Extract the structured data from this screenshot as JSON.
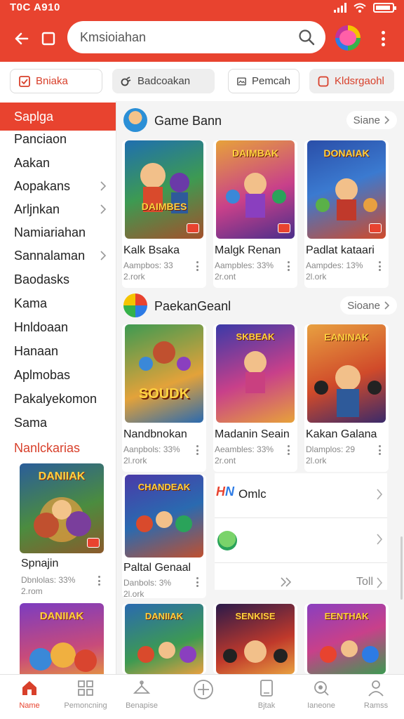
{
  "status": {
    "time": "T0C A910"
  },
  "header": {
    "search_value": "Kmsioiahan",
    "colors": {
      "primary": "#e8432f",
      "accent": "#d8402b"
    }
  },
  "chips": [
    {
      "label": "Bniaka",
      "icon": "checkbox-icon"
    },
    {
      "label": "Badcoakan",
      "icon": "link-icon"
    },
    {
      "label": "Pemcah",
      "icon": "image-icon"
    },
    {
      "label": "Kldsrgaohl",
      "icon": "square-icon"
    }
  ],
  "sidebar": {
    "active": "Saplga",
    "items": [
      {
        "label": "Panciaon",
        "chevron": false
      },
      {
        "label": "Aakan",
        "chevron": false
      },
      {
        "label": "Aopakans",
        "chevron": true
      },
      {
        "label": "Arljnkan",
        "chevron": true
      },
      {
        "label": "Namiariahan",
        "chevron": false
      },
      {
        "label": "Sannalaman",
        "chevron": true
      },
      {
        "label": "Baodasks",
        "chevron": false
      },
      {
        "label": "Kama",
        "chevron": false
      },
      {
        "label": "Hnldoaan",
        "chevron": false
      },
      {
        "label": "Hanaan",
        "chevron": false
      },
      {
        "label": "Aplmobas",
        "chevron": false
      },
      {
        "label": "Pakalyekomon",
        "chevron": false
      },
      {
        "label": "Sama",
        "chevron": false
      }
    ],
    "section_title": "Nanlckarias",
    "cards": [
      {
        "title": "Spnajin",
        "meta1": "Dbnlolas: 33%",
        "meta2": "2.rom",
        "art": "DANIIAK"
      },
      {
        "title": "",
        "meta1": "",
        "meta2": "",
        "art": "DANIIAK"
      }
    ]
  },
  "content": {
    "section1": {
      "title": "Game Bann",
      "more": "Siane",
      "games": [
        {
          "title": "Kalk Bsaka",
          "meta1": "Aampbos: 33",
          "meta2": "2.rork",
          "art": "DAIMBES"
        },
        {
          "title": "Malgk Renan",
          "meta1": "Aampbles: 33%",
          "meta2": "2r.ont",
          "art": "DAIMBAK"
        },
        {
          "title": "Padlat kataari",
          "meta1": "Aampdes: 13%",
          "meta2": "2l.ork",
          "art": "DONAIAK"
        }
      ]
    },
    "section2": {
      "title": "PaekanGeanl",
      "more": "Sioane",
      "games": [
        {
          "title": "Nandbnokan",
          "meta1": "Aanpbols: 33%",
          "meta2": "2l.rork",
          "art": "SOUDK"
        },
        {
          "title": "Madanin Seain",
          "meta1": "Aeambles: 33%",
          "meta2": "2r.ont",
          "art": "SKBEAK"
        },
        {
          "title": "Kakan Galana",
          "meta1": "Dlamplos: 29",
          "meta2": "2l.ork",
          "art": "EANINAK"
        }
      ]
    },
    "section3": {
      "game": {
        "title": "Paltal Genaal",
        "meta1": "Danbols: 3%",
        "meta2": "2l.ork",
        "art": "CHANDEAK"
      },
      "list": [
        {
          "label": "Omlc"
        },
        {
          "label": ""
        },
        {
          "label": "Toll"
        }
      ]
    },
    "bottom_row_art": [
      "DANIIAK",
      "SENKISE",
      "EENTHAK"
    ]
  },
  "bottom_nav": [
    {
      "label": "Name",
      "icon": "home-icon",
      "active": true
    },
    {
      "label": "Pemoncning",
      "icon": "grid-icon",
      "active": false
    },
    {
      "label": "Benapise",
      "icon": "hanger-icon",
      "active": false
    },
    {
      "label": "",
      "icon": "plus-circle-icon",
      "active": false
    },
    {
      "label": "Bjtak",
      "icon": "tablet-icon",
      "active": false
    },
    {
      "label": "Ianeone",
      "icon": "search-icon",
      "active": false
    },
    {
      "label": "Ramss",
      "icon": "person-icon",
      "active": false
    }
  ]
}
